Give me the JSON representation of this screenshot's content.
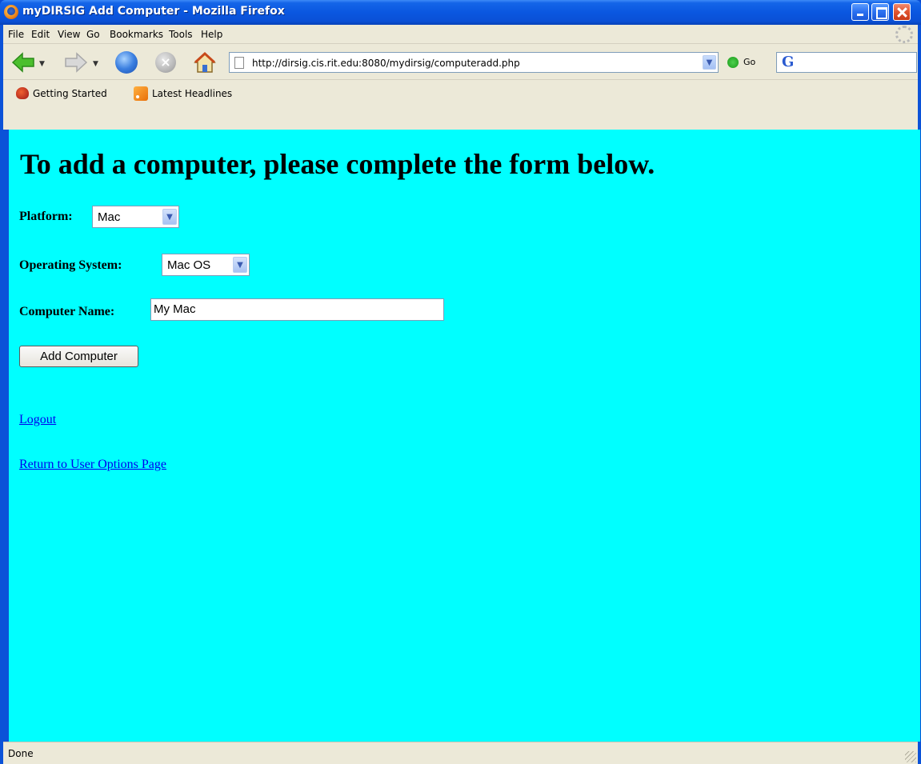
{
  "window": {
    "title": "myDIRSIG Add Computer - Mozilla Firefox"
  },
  "menu": [
    "File",
    "Edit",
    "View",
    "Go",
    "Bookmarks",
    "Tools",
    "Help"
  ],
  "toolbar": {
    "url": "http://dirsig.cis.rit.edu:8080/mydirsig/computeradd.php",
    "go_label": "Go",
    "search_engine_glyph": "G"
  },
  "bookmarks": [
    "Getting Started",
    "Latest Headlines"
  ],
  "page": {
    "heading": "To add a computer, please complete the form below.",
    "platform_label": "Platform:",
    "platform_value": "Mac",
    "os_label": "Operating System:",
    "os_value": "Mac OS",
    "name_label": "Computer Name:",
    "name_value": "My Mac",
    "submit_label": "Add Computer",
    "logout_link": "Logout",
    "return_link": "Return to User Options Page",
    "background_color": "#00ffff"
  },
  "status": {
    "text": "Done"
  }
}
